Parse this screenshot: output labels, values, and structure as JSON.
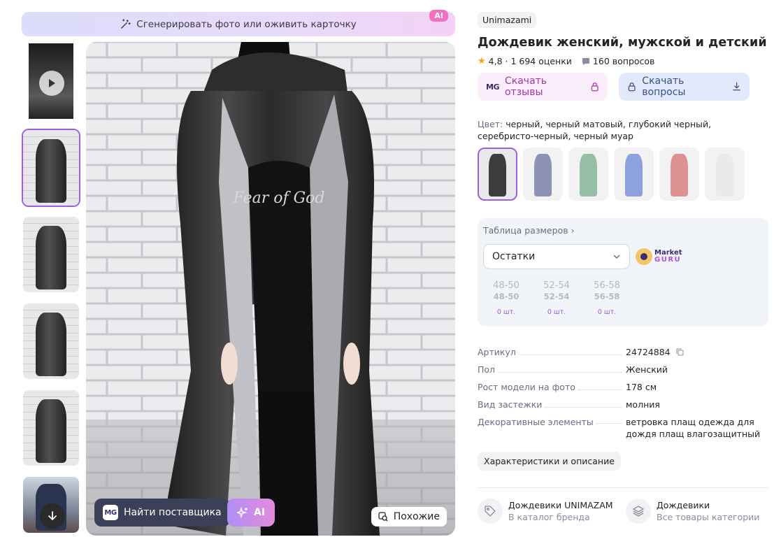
{
  "gen_banner": {
    "label": "Сгенерировать фото или оживить карточку",
    "ai_tag": "AI"
  },
  "thumbnails": [
    {
      "type": "video",
      "icon": "play-icon"
    },
    {
      "type": "photo",
      "active": true
    },
    {
      "type": "photo"
    },
    {
      "type": "photo"
    },
    {
      "type": "photo"
    },
    {
      "type": "photo"
    }
  ],
  "main_image": {
    "supplier_button": "Найти поставщика",
    "supplier_logo": "MG",
    "ai_button": "AI",
    "similar_button": "Похожие",
    "print_text": "Fear of God"
  },
  "product": {
    "brand": "Unimazami",
    "title": "Дождевик женский, мужской и детский",
    "rating": "4,8 · 1 694 оценки",
    "questions": "160 вопросов",
    "download_reviews": "Скачать отзывы",
    "download_reviews_logo": "MG",
    "download_questions": "Скачать вопросы",
    "color_label": "Цвет:",
    "color_value": "черный, черный матовый, глубокий черный, серебристо-черный, черный муар",
    "swatch_colors": [
      "#3c3c3c",
      "#2f3c7a",
      "#3f8a5c",
      "#2f56c8",
      "#c33a3a",
      "#d9d9d9"
    ]
  },
  "sizes": {
    "table_link": "Таблица размеров",
    "stock_select": "Остатки",
    "mguru_top": "Market",
    "mguru_bottom": "GURU",
    "items": [
      {
        "a": "48-50",
        "b": "48-50",
        "stock": "0 шт."
      },
      {
        "a": "52-54",
        "b": "52-54",
        "stock": "0 шт."
      },
      {
        "a": "56-58",
        "b": "56-58",
        "stock": "0 шт."
      }
    ]
  },
  "specs": [
    {
      "k": "Артикул",
      "v": "24724884",
      "copy": true
    },
    {
      "k": "Пол",
      "v": "Женский"
    },
    {
      "k": "Рост модели на фото",
      "v": "178 см"
    },
    {
      "k": "Вид застежки",
      "v": "молния"
    },
    {
      "k": "Декоративные элементы",
      "v": "ветровка плащ одежда для дождя плащ влагозащитный"
    }
  ],
  "char_button": "Характеристики и описание",
  "categories": [
    {
      "title": "Дождевики UNIMAZAMI",
      "sub": "В каталог бренда",
      "icon": "tag-icon"
    },
    {
      "title": "Дождевики",
      "sub": "Все товары категории",
      "icon": "layers-icon"
    }
  ]
}
